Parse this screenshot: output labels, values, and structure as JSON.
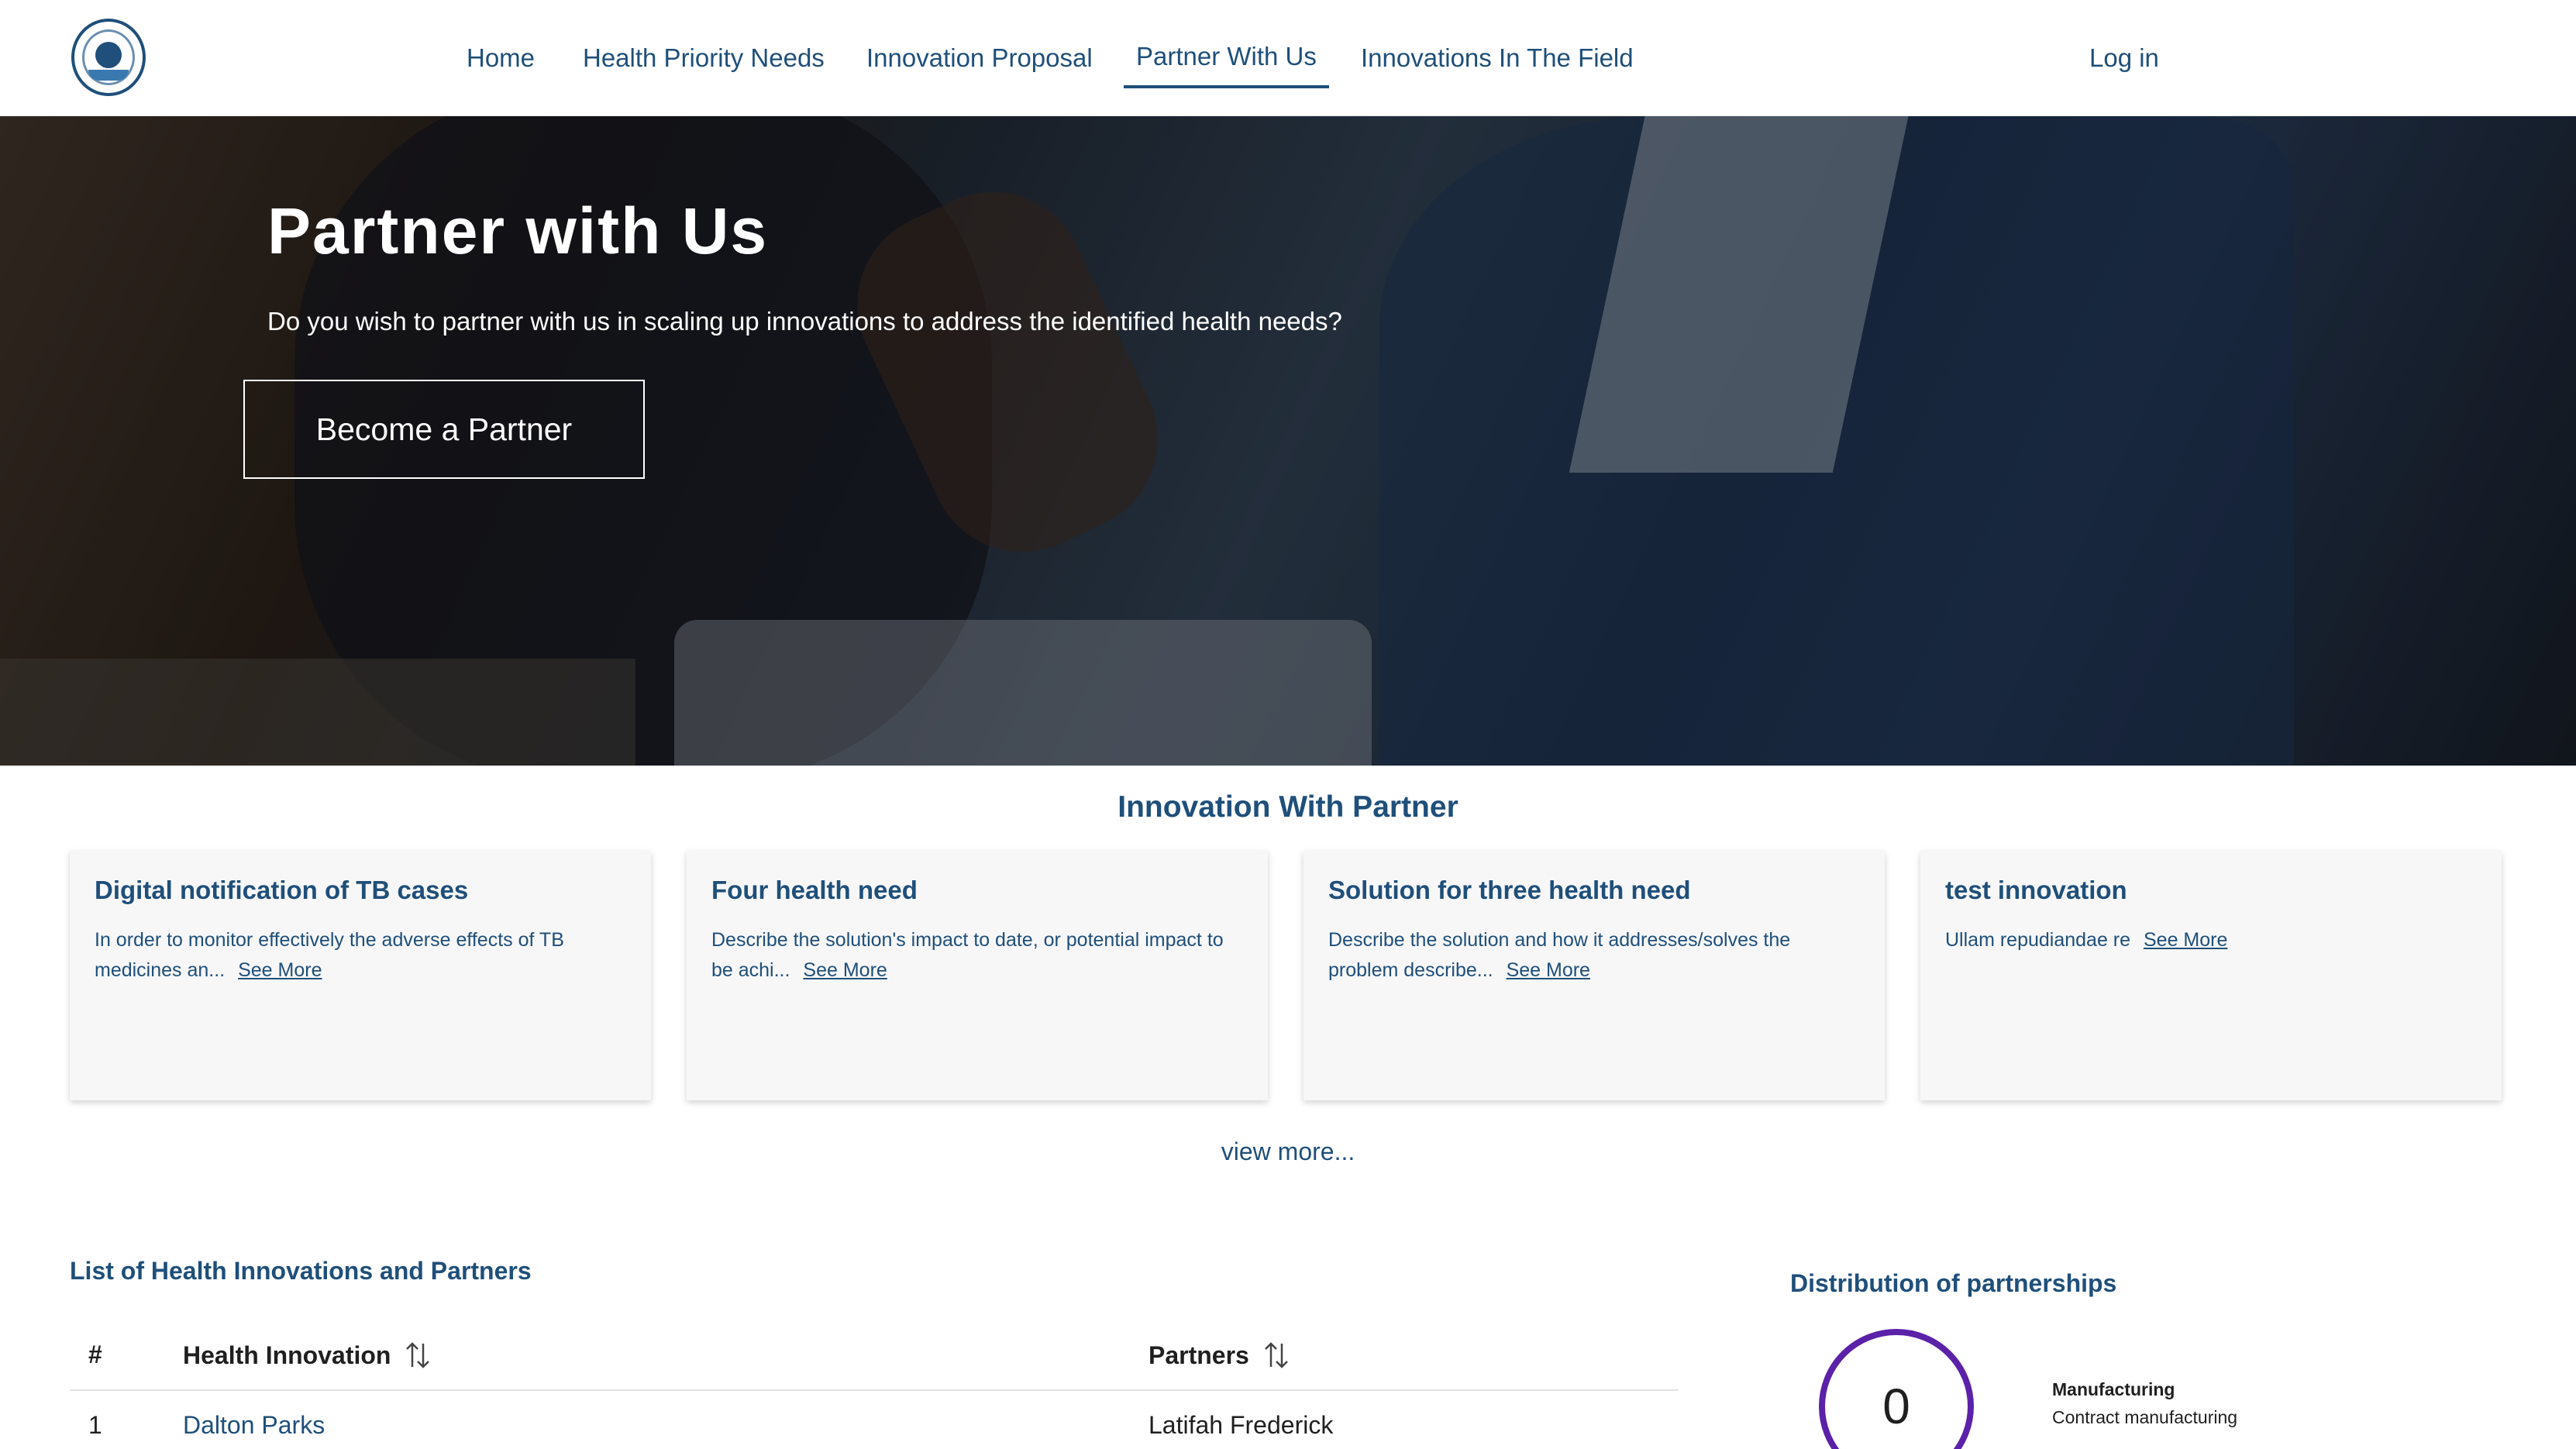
{
  "header": {
    "nav": {
      "home": "Home",
      "health_priority_needs": "Health Priority Needs",
      "innovation_proposal": "Innovation Proposal",
      "partner_with_us": "Partner With Us",
      "innovations_in_field": "Innovations In The Field",
      "login": "Log in"
    },
    "active_item": "Partner With Us"
  },
  "hero": {
    "title": "Partner with Us",
    "subtitle": "Do you wish to partner with us in scaling up innovations to address the identified health needs?",
    "button": "Become a Partner"
  },
  "innovations": {
    "section_title": "Innovation With Partner",
    "cards": [
      {
        "title": "Digital notification of TB cases",
        "desc": "In order to monitor effectively the adverse effects of TB medicines an...",
        "link": "See More"
      },
      {
        "title": "Four health need",
        "desc": "Describe the solution's impact to date, or potential impact to be achi...",
        "link": "See More"
      },
      {
        "title": "Solution for three health need",
        "desc": "Describe the solution and how it addresses/solves the problem describe...",
        "link": "See More"
      },
      {
        "title": "test innovation",
        "desc": "Ullam repudiandae re",
        "link": "See More"
      }
    ],
    "view_more": "view more..."
  },
  "table": {
    "title": "List of Health Innovations and Partners",
    "headers": {
      "num": "#",
      "innovation": "Health Innovation",
      "partners": "Partners"
    },
    "rows": [
      {
        "num": "1",
        "innovation": "Dalton Parks",
        "partners": "Latifah Frederick"
      }
    ]
  },
  "distribution": {
    "title": "Distribution of partnerships",
    "center_value": "0",
    "legend_title": "Manufacturing",
    "legend_sub": "Contract manufacturing",
    "ring_color": "#5b21a8"
  },
  "colors": {
    "brand": "#1f4f7a",
    "text": "#1f1f1f",
    "card_bg": "#f7f7f7"
  }
}
